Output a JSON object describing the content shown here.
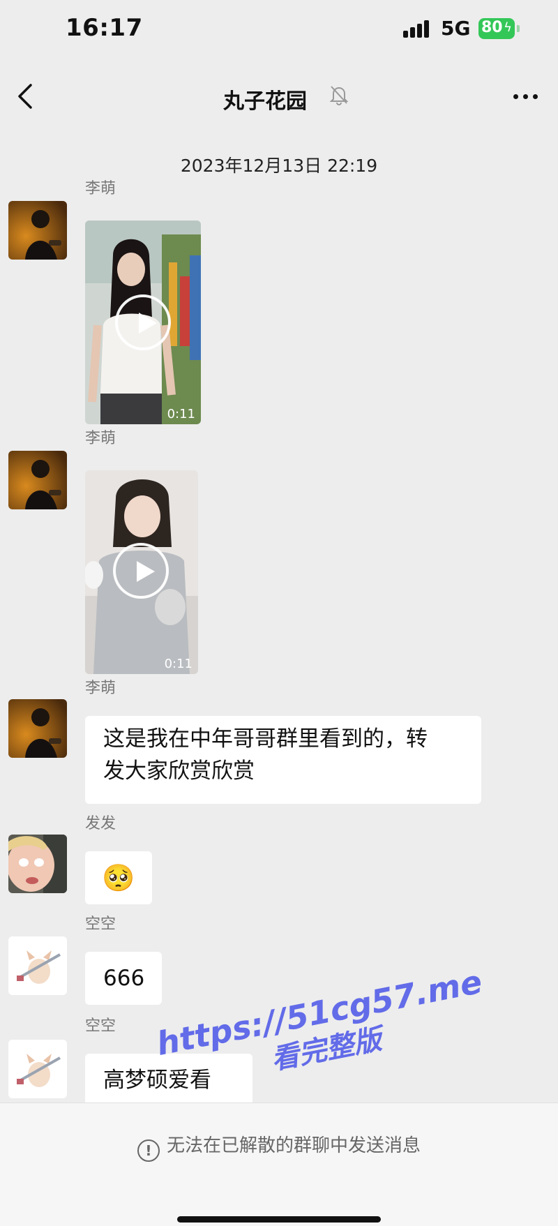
{
  "status_bar": {
    "time": "16:17",
    "network": "5G",
    "battery": "80"
  },
  "nav": {
    "title": "丸子花园"
  },
  "chat": {
    "timestamp": "2023年12月13日 22:19",
    "messages": [
      {
        "sender": "李萌",
        "type": "video",
        "duration": "0:11"
      },
      {
        "sender": "李萌",
        "type": "video",
        "duration": "0:11"
      },
      {
        "sender": "李萌",
        "type": "text",
        "text_line1": "这是我在中年哥哥群里看到的，转",
        "text_line2": "发大家欣赏欣赏"
      },
      {
        "sender": "发发",
        "type": "emoji",
        "emoji": "🥺"
      },
      {
        "sender": "空空",
        "type": "text",
        "text": "666"
      },
      {
        "sender": "空空",
        "type": "text",
        "text": "高梦硕爱看"
      }
    ]
  },
  "bottom": {
    "notice": "无法在已解散的群聊中发送消息"
  },
  "watermark": {
    "url": "https://51cg57.me",
    "subtitle": "看完整版"
  },
  "colors": {
    "background": "#ededed",
    "battery": "#33c758",
    "watermark": "#4a55e8"
  }
}
